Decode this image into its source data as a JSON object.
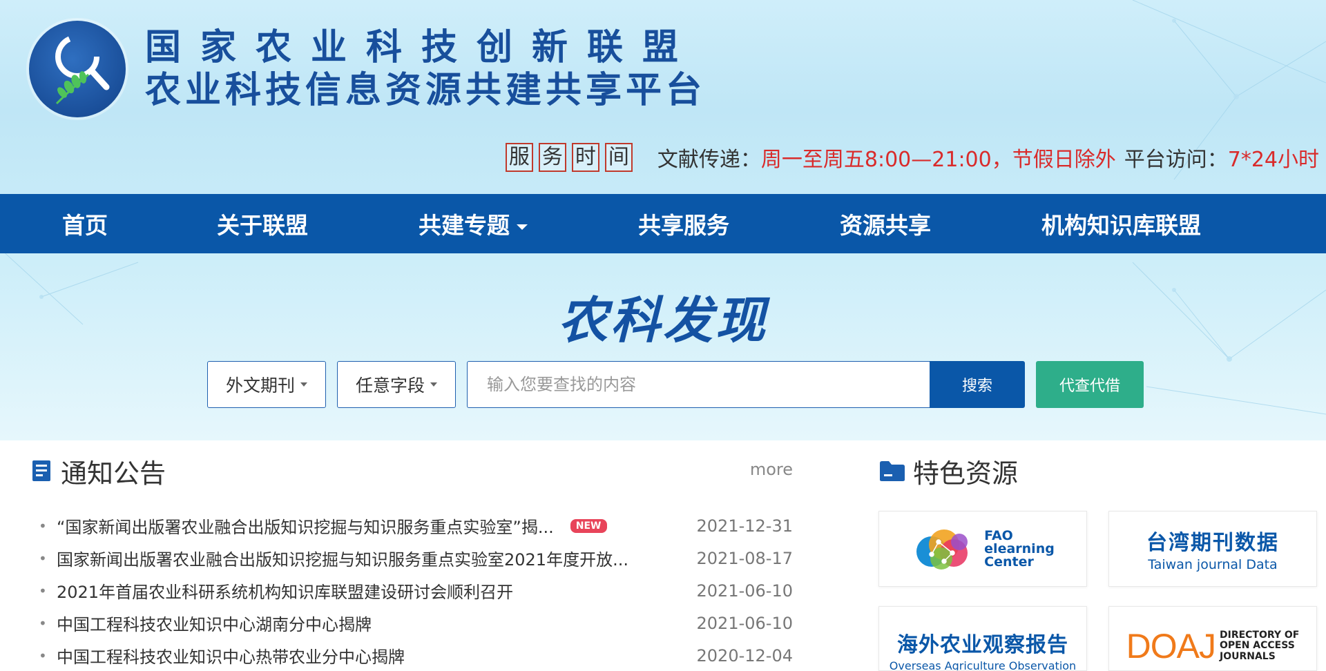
{
  "header": {
    "title_line1": "国家农业科技创新联盟",
    "title_line2": "农业科技信息资源共建共享平台",
    "service": {
      "tag_chars": [
        "服",
        "务",
        "时",
        "间"
      ],
      "doc_label": "文献传递：",
      "doc_hours": "周一至周五8:00—21:00，节假日除外",
      "access_label": "平台访问：",
      "access_hours": "7*24小时"
    }
  },
  "nav": {
    "items": [
      {
        "label": "首页"
      },
      {
        "label": "关于联盟"
      },
      {
        "label": "共建专题"
      },
      {
        "label": "共享服务"
      },
      {
        "label": "资源共享"
      },
      {
        "label": "机构知识库联盟"
      }
    ]
  },
  "search": {
    "title": "农科发现",
    "type_select": "外文期刊",
    "field_select": "任意字段",
    "placeholder": "输入您要查找的内容",
    "search_label": "搜索",
    "proxy_label": "代查代借"
  },
  "notices": {
    "title": "通知公告",
    "more": "more",
    "new_badge": "NEW",
    "items": [
      {
        "text": "“国家新闻出版署农业融合出版知识挖掘与知识服务重点实验室”揭...",
        "date": "2021-12-31",
        "is_new": true
      },
      {
        "text": "国家新闻出版署农业融合出版知识挖掘与知识服务重点实验室2021年度开放...",
        "date": "2021-08-17"
      },
      {
        "text": "2021年首届农业科研系统机构知识库联盟建设研讨会顺利召开",
        "date": "2021-06-10"
      },
      {
        "text": "中国工程科技农业知识中心湖南分中心揭牌",
        "date": "2021-06-10"
      },
      {
        "text": "中国工程科技农业知识中心热带农业分中心揭牌",
        "date": "2020-12-04"
      }
    ]
  },
  "resources": {
    "title": "特色资源",
    "fao": {
      "line1": "FAO",
      "line2": "elearning",
      "line3": "Center"
    },
    "taiwan": {
      "cn": "台湾期刊数据",
      "en": "Taiwan journal Data"
    },
    "overseas": {
      "cn": "海外农业观察报告",
      "en": "Overseas Agriculture Observation"
    },
    "doaj": {
      "logo": "DOAJ",
      "line1": "DIRECTORY OF",
      "line2": "OPEN ACCESS",
      "line3": "JOURNALS"
    }
  },
  "colors": {
    "nav_bg": "#0a57a8",
    "brand_blue": "#184f9c",
    "accent_red": "#d92b2b",
    "proxy_green": "#2eae8a",
    "doaj_orange": "#f07a1a"
  }
}
